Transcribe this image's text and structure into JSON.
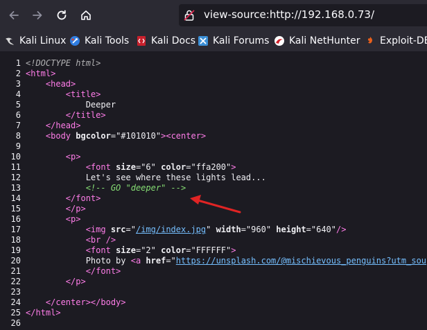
{
  "browser": {
    "url": "view-source:http://192.168.0.73/",
    "bookmarks": [
      {
        "label": "Kali Linux",
        "icon": "kali-dragon-icon"
      },
      {
        "label": "Kali Tools",
        "icon": "kali-tools-icon"
      },
      {
        "label": "Kali Docs",
        "icon": "kali-docs-icon"
      },
      {
        "label": "Kali Forums",
        "icon": "kali-forums-icon"
      },
      {
        "label": "Kali NetHunter",
        "icon": "kali-nethunter-icon"
      },
      {
        "label": "Exploit-DB",
        "icon": "exploit-db-icon"
      }
    ]
  },
  "source": {
    "line_numbers": [
      "1",
      "2",
      "3",
      "4",
      "5",
      "6",
      "7",
      "8",
      "9",
      "10",
      "11",
      "12",
      "13",
      "14",
      "15",
      "16",
      "17",
      "18",
      "19",
      "20",
      "21",
      "22",
      "23",
      "24",
      "25",
      "26"
    ],
    "l1_doctype": "<!DOCTYPE html>",
    "l2_tag": "<html>",
    "l3_indent": "    ",
    "l3_tag": "<head>",
    "l4_indent": "        ",
    "l4_tag": "<title>",
    "l5_indent": "            ",
    "l5_text": "Deeper",
    "l6_indent": "        ",
    "l6_tag": "</title>",
    "l7_indent": "    ",
    "l7_tag": "</head>",
    "l8_indent": "    ",
    "l8_open": "<body ",
    "l8_attr": "bgcolor",
    "l8_eq": "=\"",
    "l8_val": "#101010",
    "l8_q": "\"",
    "l8_close": ">",
    "l8_center": "<center>",
    "l10_indent": "        ",
    "l10_tag": "<p>",
    "l11_indent": "            ",
    "l11_open": "<font ",
    "l11_attr1": "size",
    "l11_eq1": "=\"",
    "l11_val1": "6",
    "l11_q1": "\" ",
    "l11_attr2": "color",
    "l11_eq2": "=\"",
    "l11_val2": "ffa200",
    "l11_q2": "\"",
    "l11_close": ">",
    "l12_indent": "            ",
    "l12_text": "Let's see where these lights lead...",
    "l13_indent": "            ",
    "l13_comment": "<!-- GO \"deeper\" -->",
    "l14_indent": "        ",
    "l14_tag": "</font>",
    "l15_indent": "        ",
    "l15_tag": "</p>",
    "l16_indent": "        ",
    "l16_tag": "<p>",
    "l17_indent": "            ",
    "l17_open": "<img ",
    "l17_attr1": "src",
    "l17_eq1": "=\"",
    "l17_link": "/img/index.jpg",
    "l17_q1": "\" ",
    "l17_attr2": "width",
    "l17_eq2": "=\"",
    "l17_val2": "960",
    "l17_q2": "\" ",
    "l17_attr3": "height",
    "l17_eq3": "=\"",
    "l17_val3": "640",
    "l17_q3": "\"",
    "l17_close": "/>",
    "l18_indent": "            ",
    "l18_tag": "<br />",
    "l19_indent": "            ",
    "l19_open": "<font ",
    "l19_attr1": "size",
    "l19_eq1": "=\"",
    "l19_val1": "2",
    "l19_q1": "\" ",
    "l19_attr2": "color",
    "l19_eq2": "=\"",
    "l19_val2": "FFFFFF",
    "l19_q2": "\"",
    "l19_close": ">",
    "l20_indent": "            ",
    "l20_text": "Photo by ",
    "l20_open": "<a ",
    "l20_attr": "href",
    "l20_eq": "=\"",
    "l20_link": "https://unsplash.com/@mischievous_penguins?utm_sou",
    "l21_indent": "            ",
    "l21_tag": "</font>",
    "l22_indent": "        ",
    "l22_tag": "</p>",
    "l24_indent": "    ",
    "l24_tag": "</center></body>",
    "l25_tag": "</html>"
  },
  "colors": {
    "chrome_bg": "#2b2a33",
    "source_bg": "#1c1b22",
    "tag": "#ff7de9",
    "comment": "#86de74",
    "link": "#75bfff",
    "annotation_arrow": "#e02424"
  }
}
